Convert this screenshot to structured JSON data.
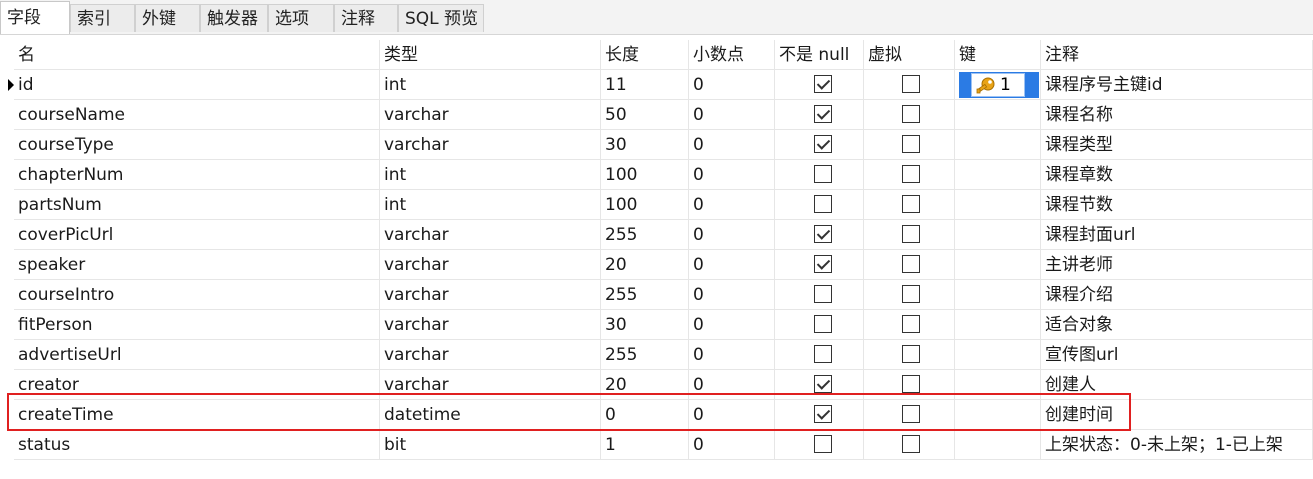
{
  "tabs": [
    {
      "label": "字段",
      "active": true
    },
    {
      "label": "索引",
      "active": false
    },
    {
      "label": "外键",
      "active": false
    },
    {
      "label": "触发器",
      "active": false
    },
    {
      "label": "选项",
      "active": false
    },
    {
      "label": "注释",
      "active": false
    },
    {
      "label": "SQL 预览",
      "active": false
    }
  ],
  "columns": {
    "name": "名",
    "type": "类型",
    "length": "长度",
    "decimals": "小数点",
    "not_null": "不是 null",
    "virtual": "虚拟",
    "key": "键",
    "comment": "注释"
  },
  "rows": [
    {
      "name": "id",
      "type": "int",
      "length": "11",
      "decimals": "0",
      "not_null": true,
      "virtual": false,
      "key": "1",
      "comment": "课程序号主键id",
      "current": true
    },
    {
      "name": "courseName",
      "type": "varchar",
      "length": "50",
      "decimals": "0",
      "not_null": true,
      "virtual": false,
      "key": "",
      "comment": "课程名称"
    },
    {
      "name": "courseType",
      "type": "varchar",
      "length": "30",
      "decimals": "0",
      "not_null": true,
      "virtual": false,
      "key": "",
      "comment": "课程类型"
    },
    {
      "name": "chapterNum",
      "type": "int",
      "length": "100",
      "decimals": "0",
      "not_null": false,
      "virtual": false,
      "key": "",
      "comment": "课程章数"
    },
    {
      "name": "partsNum",
      "type": "int",
      "length": "100",
      "decimals": "0",
      "not_null": false,
      "virtual": false,
      "key": "",
      "comment": "课程节数"
    },
    {
      "name": "coverPicUrl",
      "type": "varchar",
      "length": "255",
      "decimals": "0",
      "not_null": true,
      "virtual": false,
      "key": "",
      "comment": "课程封面url"
    },
    {
      "name": "speaker",
      "type": "varchar",
      "length": "20",
      "decimals": "0",
      "not_null": true,
      "virtual": false,
      "key": "",
      "comment": "主讲老师"
    },
    {
      "name": "courseIntro",
      "type": "varchar",
      "length": "255",
      "decimals": "0",
      "not_null": false,
      "virtual": false,
      "key": "",
      "comment": "课程介绍"
    },
    {
      "name": "fitPerson",
      "type": "varchar",
      "length": "30",
      "decimals": "0",
      "not_null": false,
      "virtual": false,
      "key": "",
      "comment": "适合对象"
    },
    {
      "name": "advertiseUrl",
      "type": "varchar",
      "length": "255",
      "decimals": "0",
      "not_null": false,
      "virtual": false,
      "key": "",
      "comment": "宣传图url"
    },
    {
      "name": "creator",
      "type": "varchar",
      "length": "20",
      "decimals": "0",
      "not_null": true,
      "virtual": false,
      "key": "",
      "comment": "创建人"
    },
    {
      "name": "createTime",
      "type": "datetime",
      "length": "0",
      "decimals": "0",
      "not_null": true,
      "virtual": false,
      "key": "",
      "comment": "创建时间",
      "highlighted": true
    },
    {
      "name": "status",
      "type": "bit",
      "length": "1",
      "decimals": "0",
      "not_null": false,
      "virtual": false,
      "key": "",
      "comment": "上架状态：0-未上架；1-已上架"
    }
  ],
  "icons": {
    "key": "key-icon",
    "row_indicator": "triangle-right-icon"
  },
  "colors": {
    "key_highlight": "#2b7be4",
    "key_icon": "#e8a317",
    "highlight_border": "#e02020"
  }
}
